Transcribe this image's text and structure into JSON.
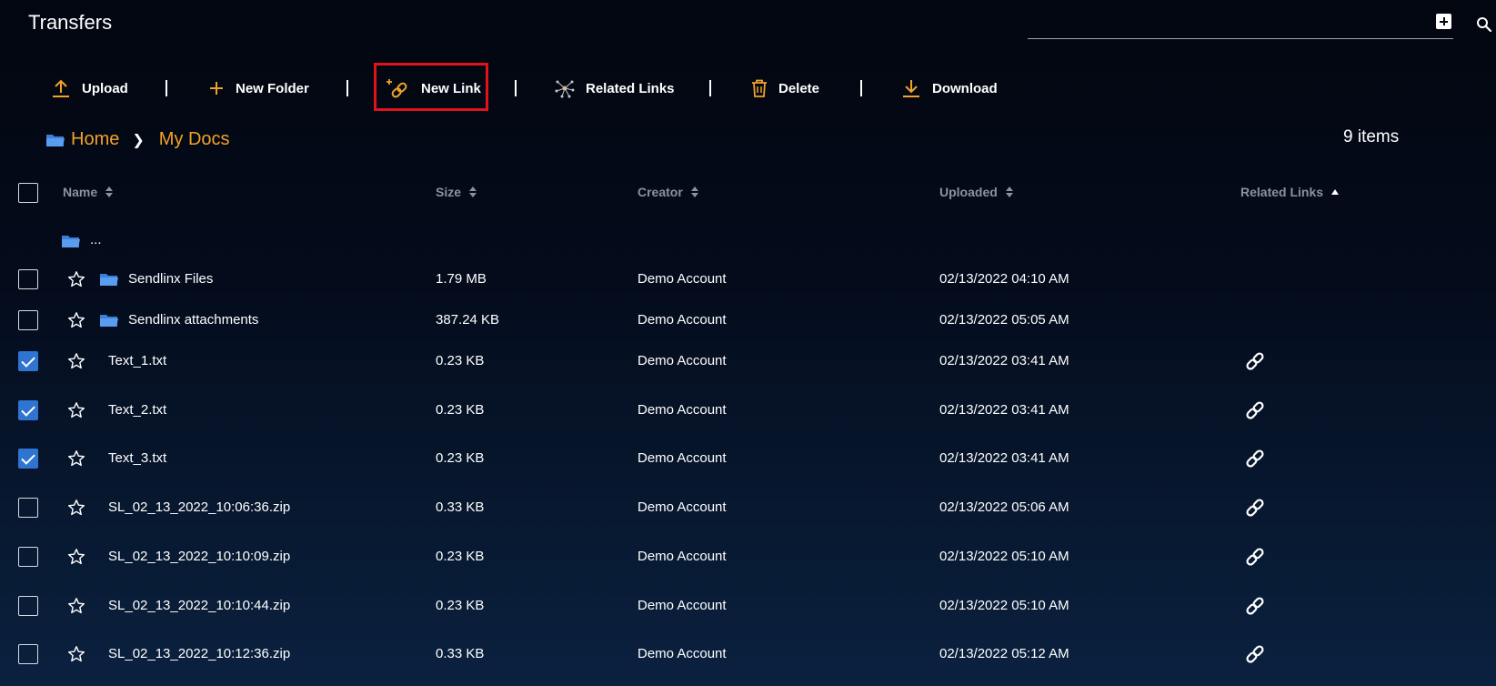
{
  "header": {
    "title": "Transfers"
  },
  "toolbar": {
    "upload": "Upload",
    "new_folder": "New Folder",
    "new_link": "New Link",
    "related_links": "Related Links",
    "delete": "Delete",
    "download": "Download"
  },
  "breadcrumb": {
    "home": "Home",
    "current": "My Docs"
  },
  "items_count": "9 items",
  "table": {
    "columns": {
      "name": "Name",
      "size": "Size",
      "creator": "Creator",
      "uploaded": "Uploaded",
      "related_links": "Related Links"
    },
    "parent_row": "...",
    "rows": [
      {
        "name": "Sendlinx Files",
        "size": "1.79 MB",
        "creator": "Demo Account",
        "uploaded": "02/13/2022 04:10 AM",
        "type": "folder",
        "checked": false,
        "has_link": false
      },
      {
        "name": "Sendlinx attachments",
        "size": "387.24 KB",
        "creator": "Demo Account",
        "uploaded": "02/13/2022 05:05 AM",
        "type": "folder",
        "checked": false,
        "has_link": false
      },
      {
        "name": "Text_1.txt",
        "size": "0.23 KB",
        "creator": "Demo Account",
        "uploaded": "02/13/2022 03:41 AM",
        "type": "file",
        "checked": true,
        "has_link": true
      },
      {
        "name": "Text_2.txt",
        "size": "0.23 KB",
        "creator": "Demo Account",
        "uploaded": "02/13/2022 03:41 AM",
        "type": "file",
        "checked": true,
        "has_link": true
      },
      {
        "name": "Text_3.txt",
        "size": "0.23 KB",
        "creator": "Demo Account",
        "uploaded": "02/13/2022 03:41 AM",
        "type": "file",
        "checked": true,
        "has_link": true
      },
      {
        "name": "SL_02_13_2022_10:06:36.zip",
        "size": "0.33 KB",
        "creator": "Demo Account",
        "uploaded": "02/13/2022 05:06 AM",
        "type": "file",
        "checked": false,
        "has_link": true
      },
      {
        "name": "SL_02_13_2022_10:10:09.zip",
        "size": "0.23 KB",
        "creator": "Demo Account",
        "uploaded": "02/13/2022 05:10 AM",
        "type": "file",
        "checked": false,
        "has_link": true
      },
      {
        "name": "SL_02_13_2022_10:10:44.zip",
        "size": "0.23 KB",
        "creator": "Demo Account",
        "uploaded": "02/13/2022 05:10 AM",
        "type": "file",
        "checked": false,
        "has_link": true
      },
      {
        "name": "SL_02_13_2022_10:12:36.zip",
        "size": "0.33 KB",
        "creator": "Demo Account",
        "uploaded": "02/13/2022 05:12 AM",
        "type": "file",
        "checked": false,
        "has_link": true
      }
    ]
  },
  "colors": {
    "accent": "#f2a22a",
    "checkbox_checked": "#2f74d0",
    "highlight": "#e0121a",
    "folder": "#4a8ee8"
  },
  "icons": {
    "upload": "upload-icon",
    "new_folder": "plus-icon",
    "new_link": "add-link-icon",
    "related_links": "network-icon",
    "delete": "trash-icon",
    "download": "download-icon",
    "search": "search-icon",
    "add": "add-box-icon"
  }
}
